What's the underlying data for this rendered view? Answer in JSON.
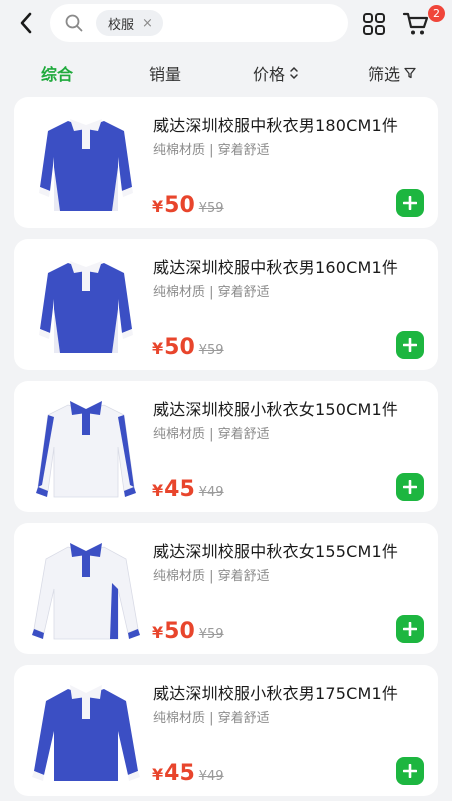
{
  "search": {
    "chip_label": "校服",
    "chip_close": "×"
  },
  "cart": {
    "badge_count": "2"
  },
  "tabs": [
    {
      "label": "综合",
      "active": true
    },
    {
      "label": "销量"
    },
    {
      "label": "价格",
      "icon": "⌃⌄"
    },
    {
      "label": "筛选",
      "icon": "filter-icon"
    }
  ],
  "products": [
    {
      "title": "威达深圳校服中秋衣男180CM1件",
      "subtitle": "纯棉材质 | 穿着舒适",
      "currency": "¥",
      "price": "50",
      "original_price": "¥59",
      "style": "blue-shirt"
    },
    {
      "title": "威达深圳校服中秋衣男160CM1件",
      "subtitle": "纯棉材质 | 穿着舒适",
      "currency": "¥",
      "price": "50",
      "original_price": "¥59",
      "style": "blue-shirt"
    },
    {
      "title": "威达深圳校服小秋衣女150CM1件",
      "subtitle": "纯棉材质 | 穿着舒适",
      "currency": "¥",
      "price": "45",
      "original_price": "¥49",
      "style": "white-shirt"
    },
    {
      "title": "威达深圳校服中秋衣女155CM1件",
      "subtitle": "纯棉材质 | 穿着舒适",
      "currency": "¥",
      "price": "50",
      "original_price": "¥59",
      "style": "white-shirt"
    },
    {
      "title": "威达深圳校服小秋衣男175CM1件",
      "subtitle": "纯棉材质 | 穿着舒适",
      "currency": "¥",
      "price": "45",
      "original_price": "¥49",
      "style": "blue-shirt"
    }
  ],
  "colors": {
    "accent_green": "#1faa3c",
    "price_red": "#e8452c",
    "shirt_blue": "#3b4fc4",
    "badge_red": "#f0453a"
  }
}
